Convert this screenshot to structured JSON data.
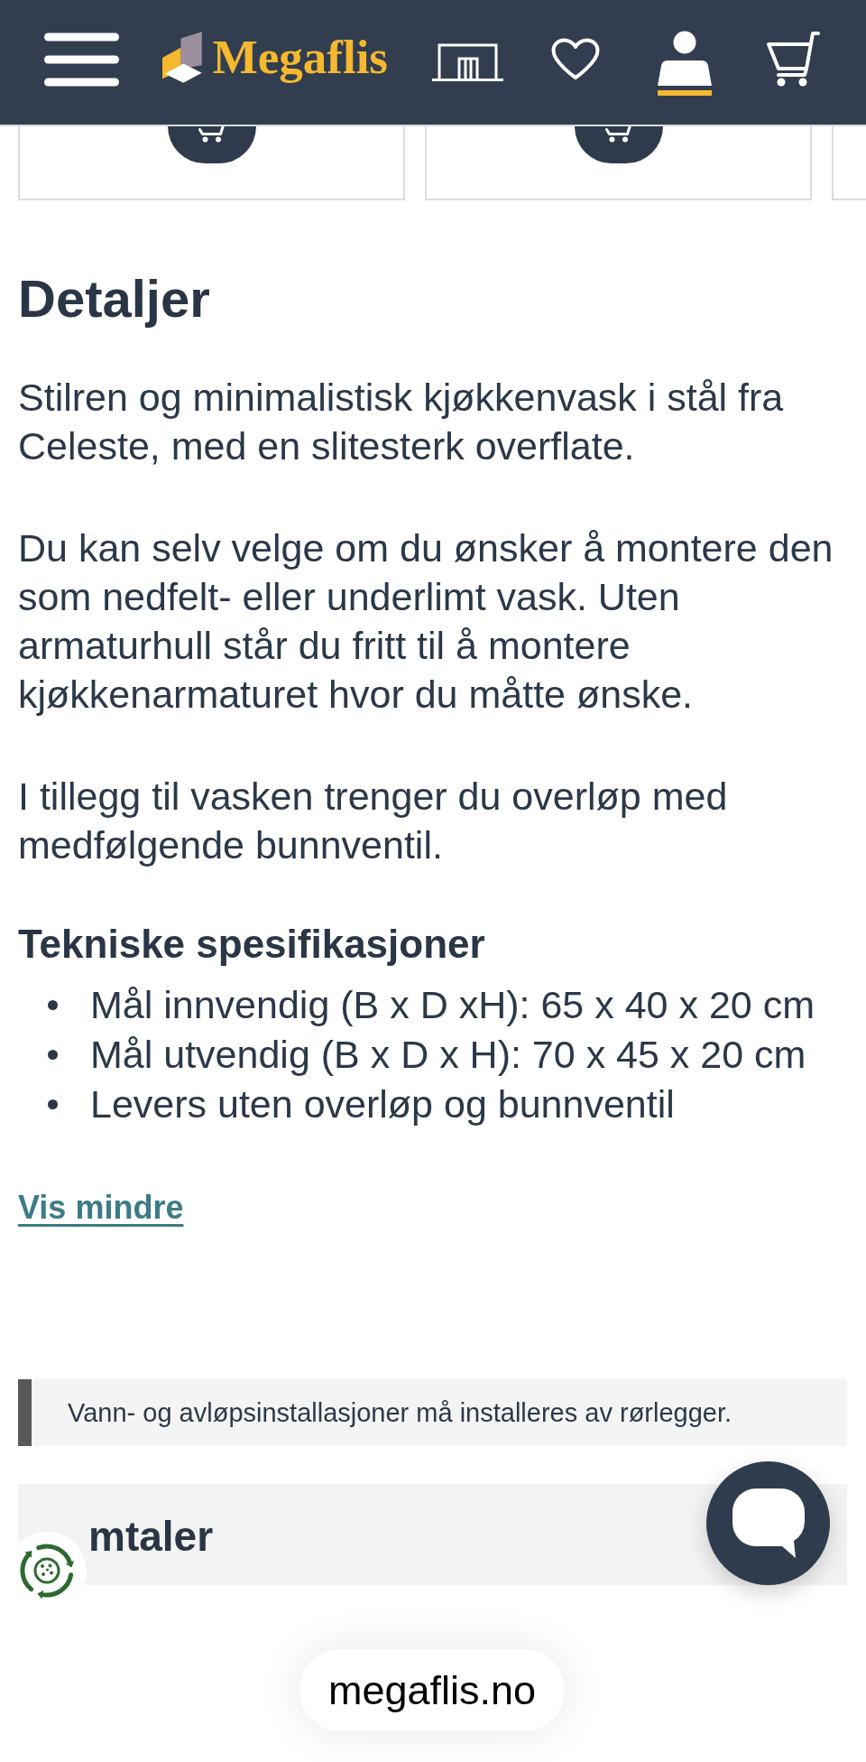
{
  "header": {
    "logo": "Megaflis",
    "nav": [
      {
        "kind": "store",
        "selected": false
      },
      {
        "kind": "favorites",
        "selected": false
      },
      {
        "kind": "account",
        "selected": true
      },
      {
        "kind": "cart",
        "selected": false
      }
    ]
  },
  "product_cards": [
    {
      "cart_button": true
    },
    {
      "cart_button": true
    },
    {
      "cart_button": false
    }
  ],
  "details": {
    "title": "Detaljer",
    "paragraphs": [
      "Stilren og minimalistisk kjøkkenvask i stål fra Celeste, med en slitesterk overflate.",
      "Du kan selv velge om du ønsker å montere den som nedfelt- eller underlimt vask. Uten armaturhull står du fritt til å montere kjøkkenarmaturet hvor du måtte ønske.",
      "I tillegg til vasken trenger du overløp med medfølgende bunnventil."
    ],
    "specs_title": "Tekniske spesifikasjoner",
    "specs": [
      "Mål innvendig (B x D xH): 65 x 40 x 20 cm",
      "Mål utvendig (B x D x H): 70 x 45 x 20 cm",
      "Levers uten overløp og bunnventil"
    ],
    "toggle_link": "Vis mindre"
  },
  "notice": {
    "text": "Vann- og avløpsinstallasjoner må installeres av rørlegger."
  },
  "reviews": {
    "title": "mtaler"
  },
  "browser": {
    "address": "megaflis.no"
  }
}
